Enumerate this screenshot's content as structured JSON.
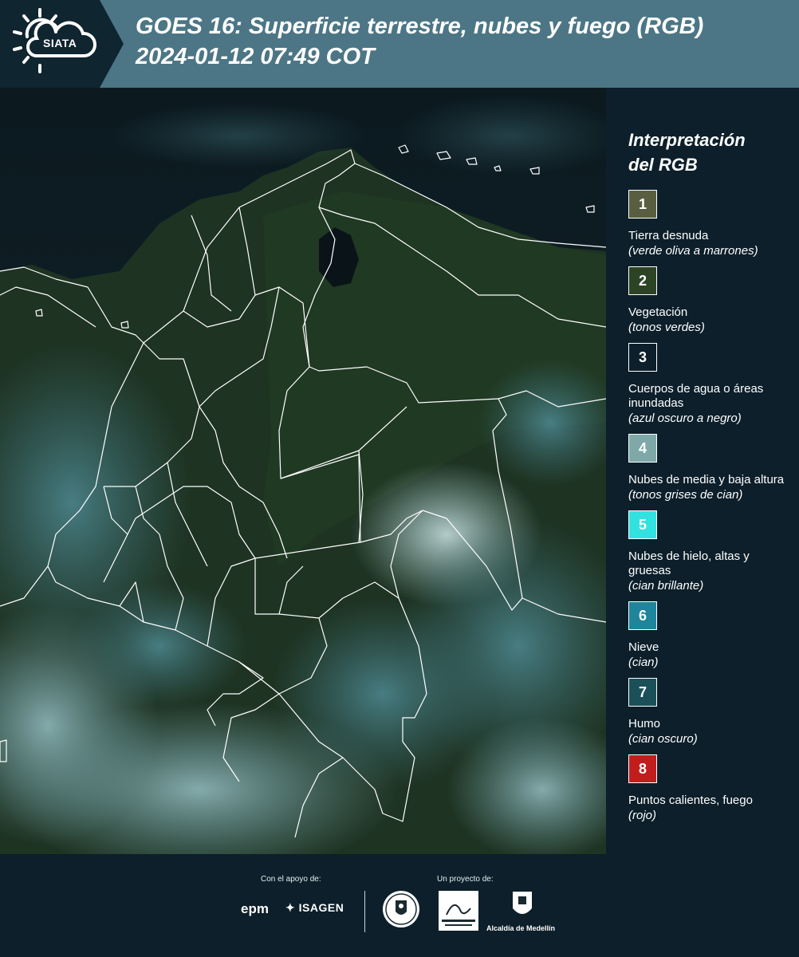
{
  "header": {
    "logo_text": "SIATA",
    "title_line1": "GOES 16: Superficie terrestre, nubes y fuego (RGB)",
    "title_line2": "2024-01-12 07:49 COT"
  },
  "colors": {
    "header_bg": "#4c7685",
    "logo_bg": "#0f2530",
    "page_bg": "#0c1f2a",
    "border_lines": "#ffffff"
  },
  "legend": {
    "title_line1": "Interpretación",
    "title_line2": "del RGB",
    "items": [
      {
        "number": "1",
        "label": "Tierra desnuda",
        "description": "(verde oliva a marrones)",
        "color": "#5a5e40"
      },
      {
        "number": "2",
        "label": "Vegetación",
        "description": "(tonos verdes)",
        "color": "#2d4424"
      },
      {
        "number": "3",
        "label": "Cuerpos de agua o áreas inundadas",
        "description": "(azul oscuro a negro)",
        "color": "#0c1f2a"
      },
      {
        "number": "4",
        "label": "Nubes de media y baja altura",
        "description": "(tonos grises de cian)",
        "color": "#7fa9a9"
      },
      {
        "number": "5",
        "label": "Nubes de hielo, altas y gruesas",
        "description": "(cian brillante)",
        "color": "#31e2e0"
      },
      {
        "number": "6",
        "label": "Nieve",
        "description": "(cian)",
        "color": "#1e859a"
      },
      {
        "number": "7",
        "label": "Humo",
        "description": "(cian oscuro)",
        "color": "#1c5058"
      },
      {
        "number": "8",
        "label": "Puntos calientes, fuego",
        "description": "(rojo)",
        "color": "#c21d1d"
      }
    ]
  },
  "footer": {
    "support_label": "Con el apoyo de:",
    "project_label": "Un proyecto de:",
    "sponsor1": "epm",
    "sponsor2": "ISAGEN",
    "partner_area": "Área Metropolitana",
    "partner_alcaldia": "Alcaldía de Medellín"
  }
}
